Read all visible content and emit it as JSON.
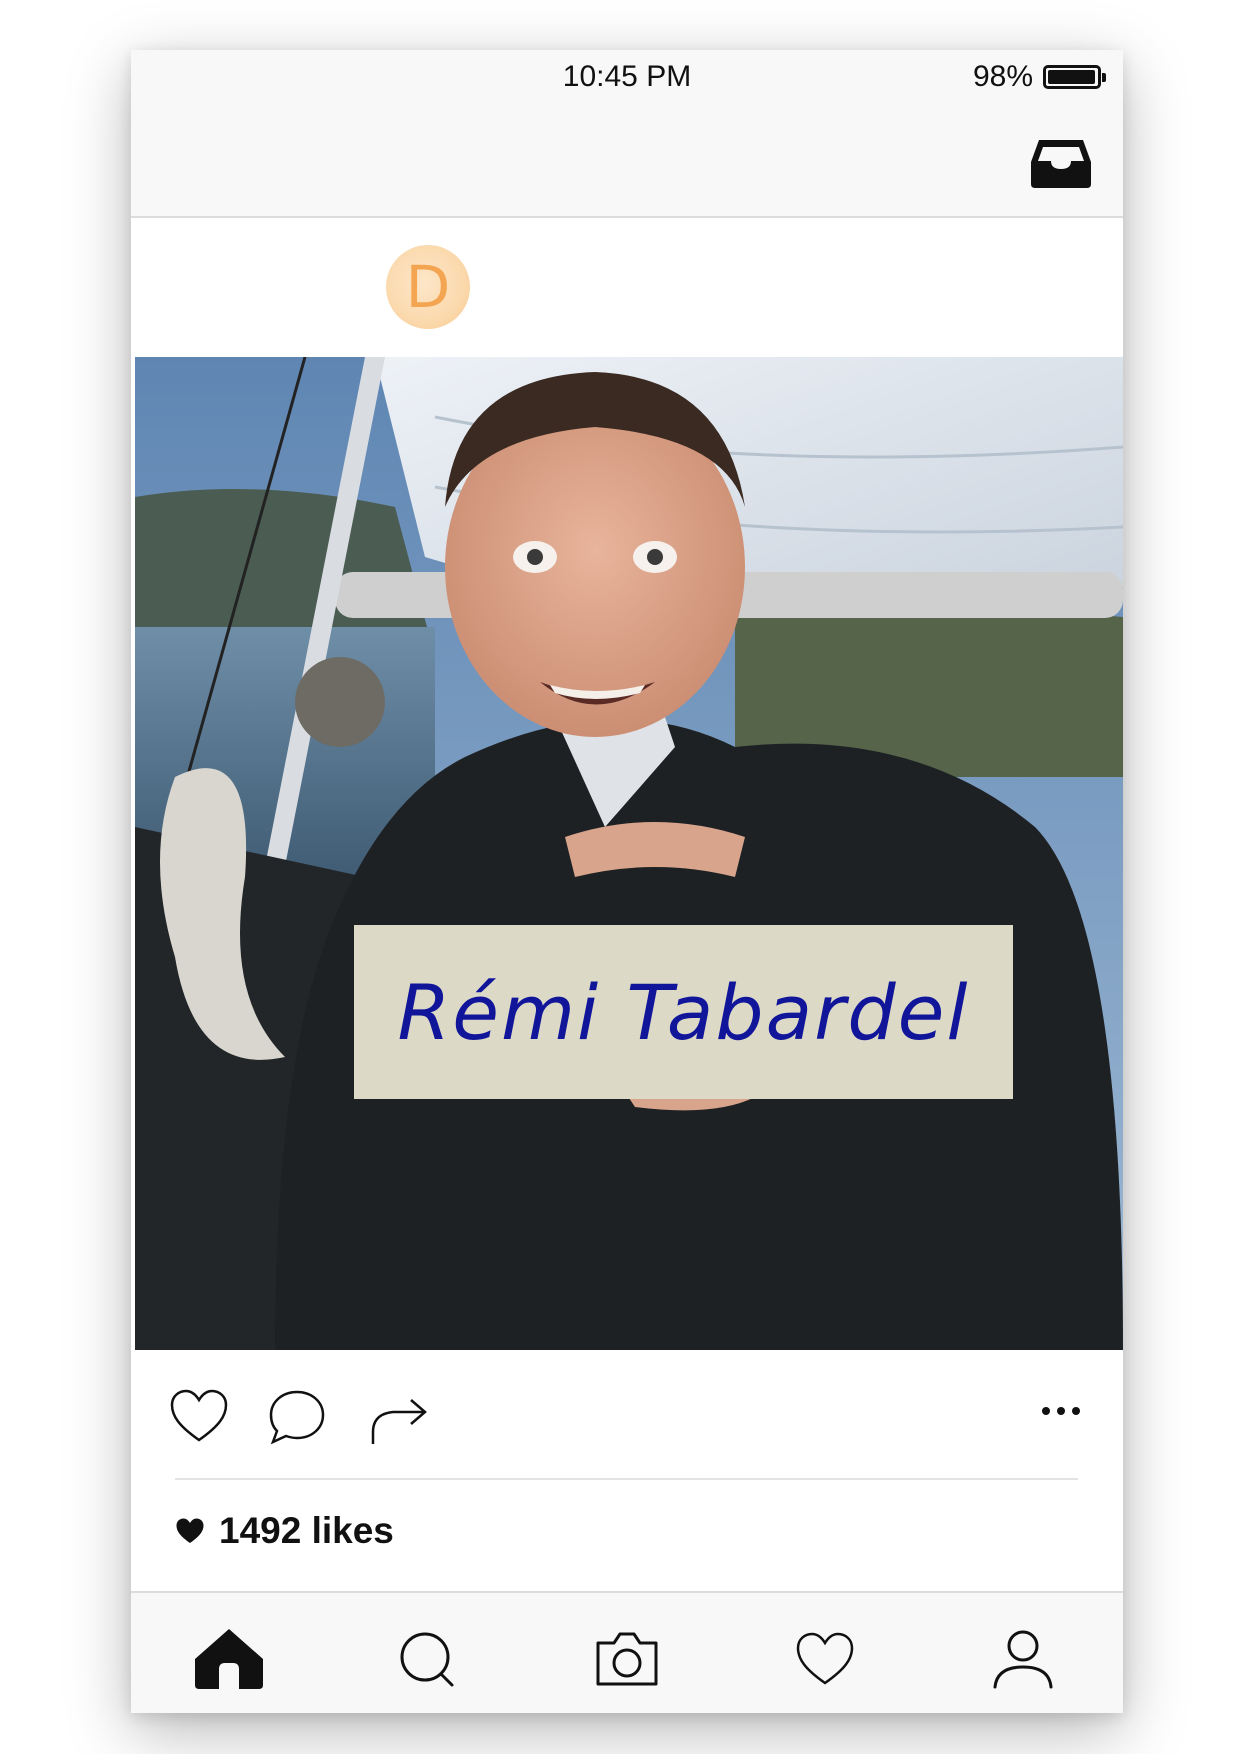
{
  "status_bar": {
    "time": "10:45 PM",
    "battery_percent_label": "98%",
    "battery_level": 0.98
  },
  "header": {
    "inbox_icon": "inbox-tray-icon"
  },
  "post": {
    "avatar_letter": "D",
    "avatar_color": "#f3a552",
    "name_card_text": "Rémi Tabardel",
    "name_card_color": "#10159a",
    "likes_text": "1492 likes"
  },
  "actions": {
    "icons": [
      "heart-icon",
      "comment-bubble-icon",
      "share-arrow-icon",
      "more-dots-icon"
    ]
  },
  "bottom_nav": {
    "items": [
      "home-icon",
      "search-icon",
      "camera-icon",
      "heart-icon",
      "profile-icon"
    ],
    "active": "home-icon"
  }
}
